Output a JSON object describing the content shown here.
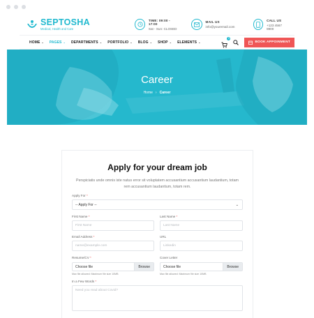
{
  "brand": {
    "name": "SEPTOSHA",
    "tagline": "Medical, Health and Care"
  },
  "header_info": [
    {
      "icon": "clock-icon",
      "label": "TIME: 09:00 - 17:00",
      "value": "Sat - Sun: CLOSED"
    },
    {
      "icon": "mail-icon",
      "label": "MAIL US",
      "value": "info@youremail.com"
    },
    {
      "icon": "phone-icon",
      "label": "CALL US",
      "value": "+123 4567 8900"
    }
  ],
  "nav": {
    "items": [
      {
        "label": "HOME",
        "active": false
      },
      {
        "label": "PAGES",
        "active": true
      },
      {
        "label": "DEPARTMENTS",
        "active": false
      },
      {
        "label": "PORTFOLIO",
        "active": false
      },
      {
        "label": "BLOG",
        "active": false
      },
      {
        "label": "SHOP",
        "active": false
      },
      {
        "label": "ELEMENTS",
        "active": false
      }
    ],
    "cart_count": "0",
    "appointment_label": "BOOK APPOINMENT"
  },
  "hero": {
    "title": "Career",
    "breadcrumb_home": "Home",
    "breadcrumb_sep": "›",
    "breadcrumb_current": "Career"
  },
  "form": {
    "title": "Apply for your dream job",
    "description": "Perspiciatis unde omnis iste natus error sit voluptatem accusantium accusantium laudantium, totam rem accusantium laudantium, totam rem.",
    "apply_for": {
      "label": "Apply For",
      "value": "-- Apply For --"
    },
    "first_name": {
      "label": "First Name",
      "placeholder": "First Name"
    },
    "last_name": {
      "label": "Last Name",
      "placeholder": "Last Name"
    },
    "email": {
      "label": "Email Address",
      "placeholder": "name@example.com"
    },
    "url": {
      "label": "URL",
      "placeholder": "Linkedin"
    },
    "resume": {
      "label": "Resume/CV",
      "button": "Browse",
      "file_text": "Choose file",
      "hint": "Max file allowed: Maximum file size 10MB"
    },
    "cover": {
      "label": "Cover Letter",
      "button": "Browse",
      "file_text": "Choose file",
      "hint": "Max file allowed: Maximum file size 10MB"
    },
    "words": {
      "label": "In a Few Words",
      "placeholder": "Need you read about Covid?"
    },
    "required_mark": "*"
  },
  "colors": {
    "accent": "#20b9cf",
    "cta": "#ef5656"
  }
}
